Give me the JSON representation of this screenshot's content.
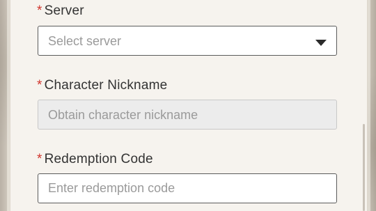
{
  "form": {
    "required_mark": "*",
    "server": {
      "label": "Server",
      "placeholder": "Select server"
    },
    "nickname": {
      "label": "Character Nickname",
      "placeholder": "Obtain character nickname"
    },
    "redemption": {
      "label": "Redemption Code",
      "placeholder": "Enter redemption code"
    }
  },
  "icons": {
    "dropdown": "chevron-down-icon"
  },
  "colors": {
    "required": "#d0342c",
    "label_text": "#333333",
    "placeholder_text": "#9a9a9a",
    "card_background": "#f6f3ee",
    "disabled_field": "#ececec"
  }
}
